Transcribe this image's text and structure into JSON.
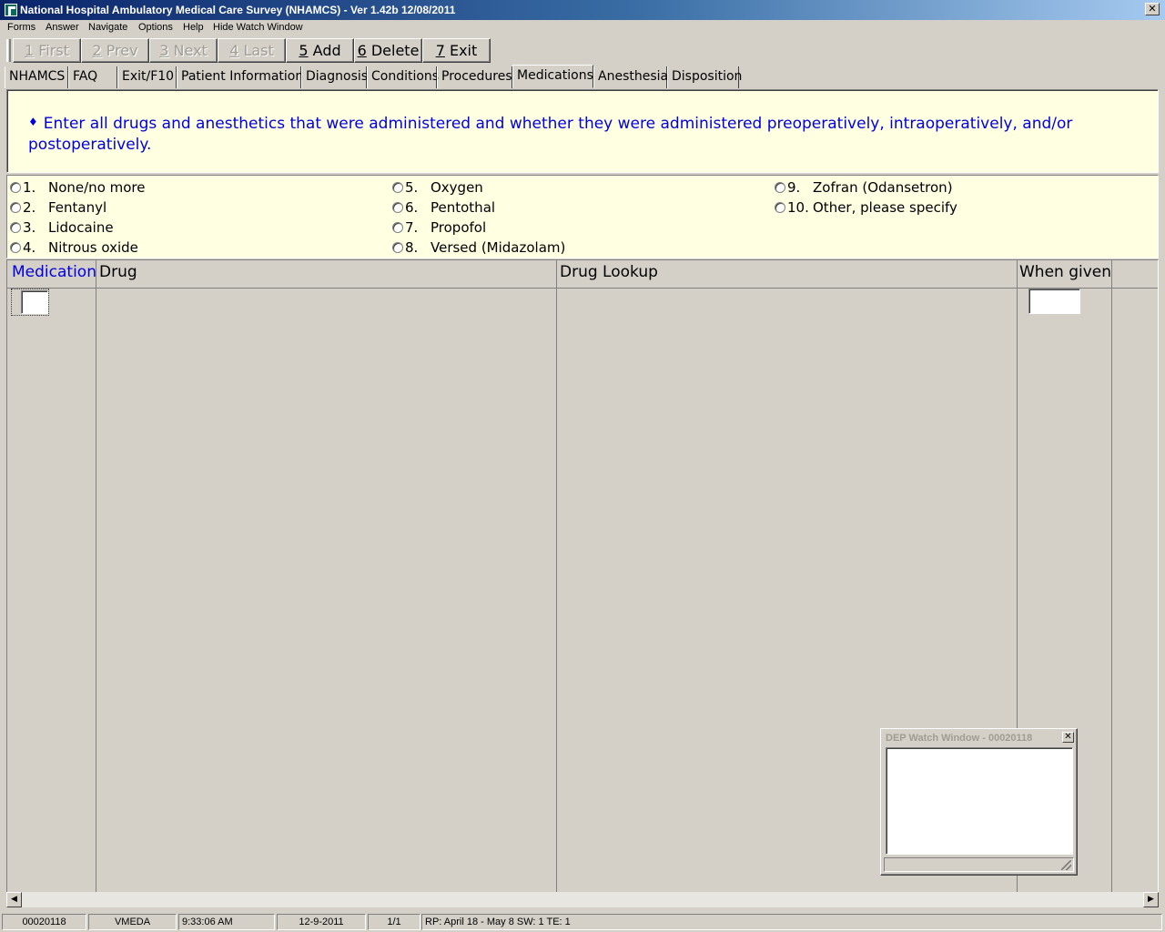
{
  "window": {
    "title": "National Hospital Ambulatory Medical Care Survey (NHAMCS) - Ver 1.42b 12/08/2011",
    "close_glyph": "✕"
  },
  "menu": [
    "Forms",
    "Answer",
    "Navigate",
    "Options",
    "Help",
    "Hide Watch Window"
  ],
  "toolbar": {
    "buttons": [
      {
        "key": "1",
        "label": " First",
        "enabled": false
      },
      {
        "key": "2",
        "label": " Prev",
        "enabled": false
      },
      {
        "key": "3",
        "label": " Next",
        "enabled": false
      },
      {
        "key": "4",
        "label": " Last",
        "enabled": false
      },
      {
        "key": "5",
        "label": " Add",
        "enabled": true
      },
      {
        "key": "6",
        "label": " Delete",
        "enabled": true
      },
      {
        "key": "7",
        "label": " Exit",
        "enabled": true
      }
    ]
  },
  "tabs": [
    {
      "label": "NHAMCS"
    },
    {
      "label": "FAQ"
    },
    {
      "label": "Exit/F10"
    },
    {
      "label": "Patient Information"
    },
    {
      "label": "Diagnosis"
    },
    {
      "label": "Conditions"
    },
    {
      "label": "Procedures"
    },
    {
      "label": "Medications",
      "active": true
    },
    {
      "label": "Anesthesia"
    },
    {
      "label": "Disposition"
    }
  ],
  "instruction": {
    "bullet": "♦",
    "text": "Enter all drugs and anesthetics that were administered and whether they were administered preoperatively, intraoperatively, and/or postoperatively."
  },
  "options": [
    {
      "num": "1.",
      "label": "None/no more"
    },
    {
      "num": "2.",
      "label": "Fentanyl"
    },
    {
      "num": "3.",
      "label": "Lidocaine"
    },
    {
      "num": "4.",
      "label": "Nitrous oxide"
    },
    {
      "num": "5.",
      "label": "Oxygen"
    },
    {
      "num": "6.",
      "label": "Pentothal"
    },
    {
      "num": "7.",
      "label": "Propofol"
    },
    {
      "num": "8.",
      "label": "Versed (Midazolam)"
    },
    {
      "num": "9.",
      "label": "Zofran (Odansetron)"
    },
    {
      "num": "10.",
      "label": "Other, please specify"
    }
  ],
  "grid": {
    "columns": [
      "Medication",
      "Drug",
      "Drug Lookup",
      "When given"
    ],
    "active_column": "Medication",
    "medication_value": "",
    "when_given_value": ""
  },
  "scrollbar": {
    "left_arrow": "◀",
    "right_arrow": "▶"
  },
  "watch_window": {
    "title": "DEP Watch Window - 00020118",
    "close_glyph": "✕",
    "content": ""
  },
  "status": {
    "case_id": "00020118",
    "user": "VMEDA",
    "time": "9:33:06 AM",
    "date": "12-9-2011",
    "record": "1/1",
    "info": "RP: April 18 - May 8   SW: 1   TE: 1"
  },
  "colors": {
    "accent_text": "#0000e0",
    "panel_bg": "#ffffe1",
    "title_bar": "#0a246a"
  }
}
